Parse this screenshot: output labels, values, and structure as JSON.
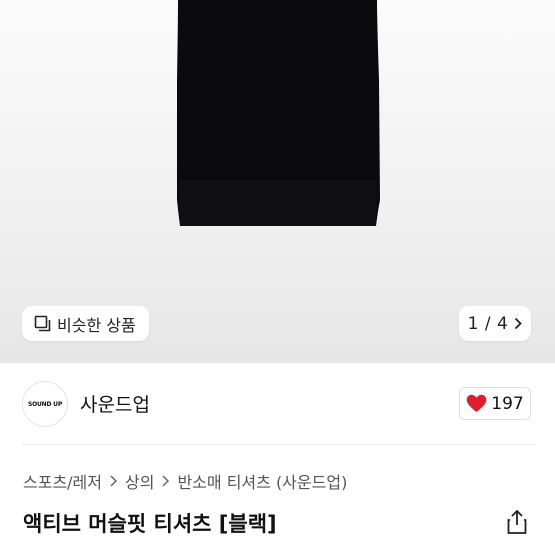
{
  "product_image": {
    "similar_products_label": "비슷한 상품",
    "image_counter": "1 / 4",
    "icons": {
      "similar": "similar-products-icon",
      "next": "chevron-right-icon"
    }
  },
  "brand": {
    "logo_text": "SOUND UP",
    "name": "사운드업"
  },
  "like": {
    "count": "197",
    "heart_color": "#e11d2b"
  },
  "breadcrumb": {
    "items": [
      "스포츠/레저",
      "상의",
      "반소매 티셔츠 (사운드업)"
    ]
  },
  "product": {
    "title": "액티브 머슬핏 티셔츠 [블랙]"
  },
  "colors": {
    "shirt": "#0b0b0d",
    "background": "#f1f1f1"
  }
}
